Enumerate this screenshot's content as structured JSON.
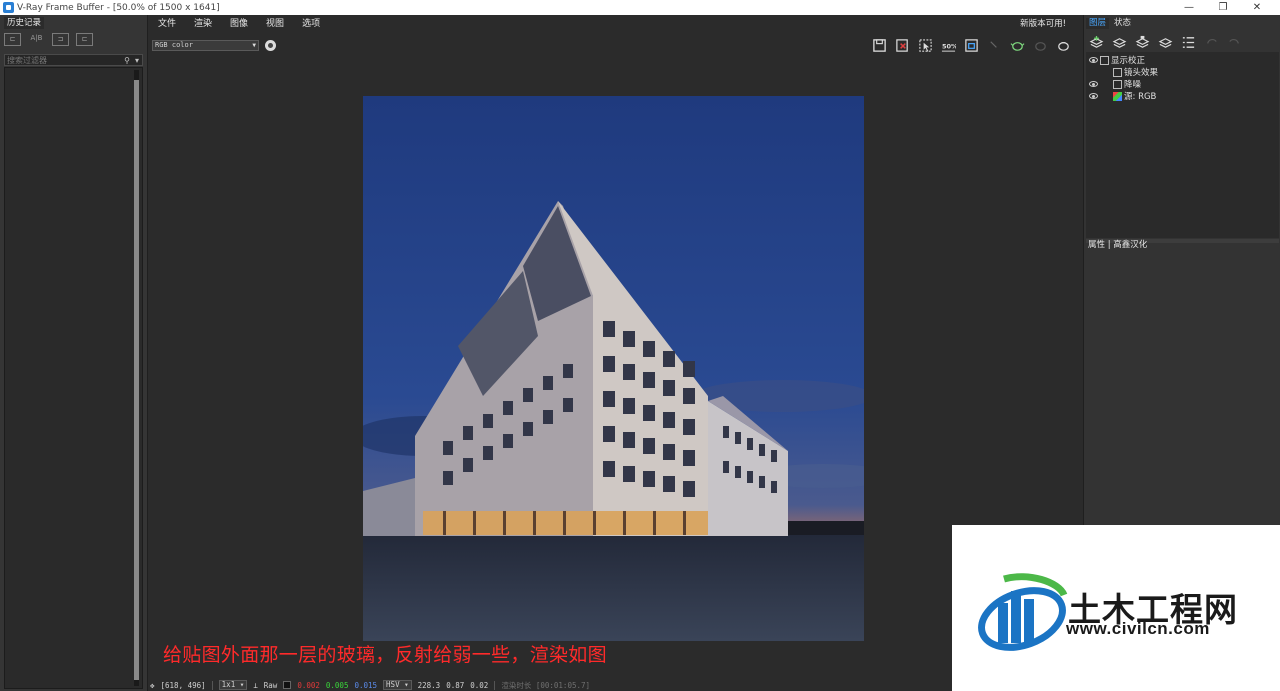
{
  "window": {
    "title": "V-Ray Frame Buffer - [50.0% of 1500 x 1641]",
    "buttons": [
      "—",
      "❐",
      "✕"
    ]
  },
  "history_panel": {
    "tab": "历史记录",
    "filter_placeholder": "搜索过滤器"
  },
  "menubar": {
    "items": [
      "文件",
      "渲染",
      "图像",
      "视图",
      "选项"
    ],
    "new_version": "新版本可用!"
  },
  "toolbar": {
    "channel": "RGB color"
  },
  "render": {
    "caption": "给贴图外面那一层的玻璃，反射给弱一些，渲染如图"
  },
  "statusbar": {
    "coords": "[618, 496]",
    "zoom": "1x1",
    "raw_label": "Raw",
    "r": "0.002",
    "g": "0.005",
    "b": "0.015",
    "mode": "HSV",
    "h": "228.3",
    "s": "0.87",
    "v": "0.02",
    "render_time": "渲染时长 [00:01:05.7]"
  },
  "layers_panel": {
    "tabs": [
      "图层",
      "状态"
    ],
    "layers": [
      {
        "label": "显示校正",
        "visible": true
      },
      {
        "label": "镜头效果",
        "visible": false
      },
      {
        "label": "降噪",
        "visible": true
      },
      {
        "label": "源: RGB",
        "visible": true
      }
    ],
    "properties_title": "属性 | 高鑫汉化"
  },
  "watermark": {
    "name": "土木工程网",
    "url": "www.civilcn.com"
  },
  "colors": {
    "accent": "#4aa8ff",
    "caption": "#ff2a2a",
    "panel": "#333333"
  }
}
